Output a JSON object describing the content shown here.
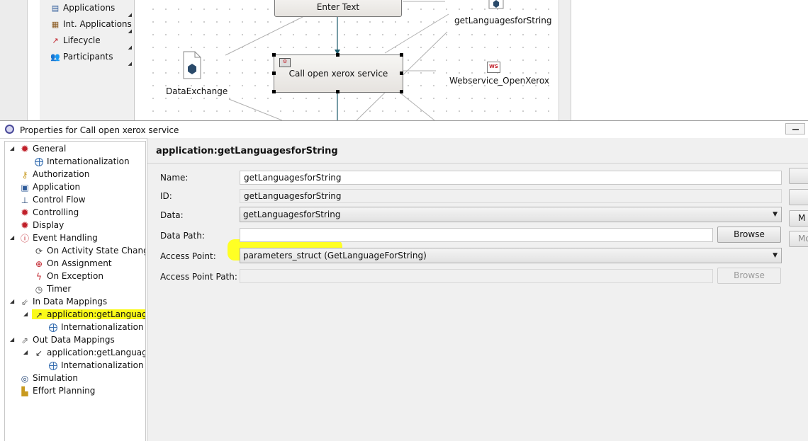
{
  "palette": {
    "items": [
      {
        "label": "Applications",
        "icon": "applications-icon"
      },
      {
        "label": "Int. Applications",
        "icon": "int-applications-icon"
      },
      {
        "label": "Lifecycle",
        "icon": "lifecycle-icon"
      },
      {
        "label": "Participants",
        "icon": "participants-icon"
      }
    ]
  },
  "diagram": {
    "top_node_label": "Enter Text",
    "selected_node_label": "Call open xerox service",
    "data_label": "DataExchange",
    "app1_label": "getLanguagesforString",
    "app2_label": "Webservice_OpenXerox",
    "ws_icon_text": "WS"
  },
  "properties": {
    "window_title": "Properties for Call open xerox service",
    "tree": [
      {
        "label": "General",
        "icon": "gear-icon"
      },
      {
        "label": "Internationalization",
        "icon": "globe-icon"
      },
      {
        "label": "Authorization",
        "icon": "key-icon"
      },
      {
        "label": "Application",
        "icon": "application-icon"
      },
      {
        "label": "Control Flow",
        "icon": "control-flow-icon"
      },
      {
        "label": "Controlling",
        "icon": "gear-icon"
      },
      {
        "label": "Display",
        "icon": "gear-icon"
      },
      {
        "label": "Event Handling",
        "icon": "event-icon"
      },
      {
        "label": "On Activity State Change",
        "icon": "activity-state-icon"
      },
      {
        "label": "On Assignment",
        "icon": "assignment-icon"
      },
      {
        "label": "On Exception",
        "icon": "exception-icon"
      },
      {
        "label": "Timer",
        "icon": "timer-icon"
      },
      {
        "label": "In Data Mappings",
        "icon": "in-mapping-icon"
      },
      {
        "label": "application:getLanguages",
        "icon": "mapping-icon"
      },
      {
        "label": "Internationalization",
        "icon": "globe-icon"
      },
      {
        "label": "Out Data Mappings",
        "icon": "out-mapping-icon"
      },
      {
        "label": "application:getLanguages",
        "icon": "mapping-icon"
      },
      {
        "label": "Internationalization",
        "icon": "globe-icon"
      },
      {
        "label": "Simulation",
        "icon": "simulation-icon"
      },
      {
        "label": "Effort Planning",
        "icon": "effort-icon"
      }
    ],
    "page_title": "application:getLanguagesforString",
    "form": {
      "name_label": "Name:",
      "name_value": "getLanguagesforString",
      "id_label": "ID:",
      "id_value": "getLanguagesforString",
      "data_label": "Data:",
      "data_value": "getLanguagesforString",
      "datapath_label": "Data Path:",
      "datapath_value": "",
      "browse_label": "Browse",
      "accesspoint_label": "Access Point:",
      "accesspoint_value": "parameters_struct (GetLanguageForString)",
      "accesspointpath_label": "Access Point Path:",
      "accesspointpath_value": "",
      "browse2_label": "Browse"
    },
    "side_buttons": [
      "",
      "",
      "M",
      "Mo"
    ],
    "colors": {
      "highlight": "#ffff18",
      "gear": "#c0202a"
    }
  }
}
